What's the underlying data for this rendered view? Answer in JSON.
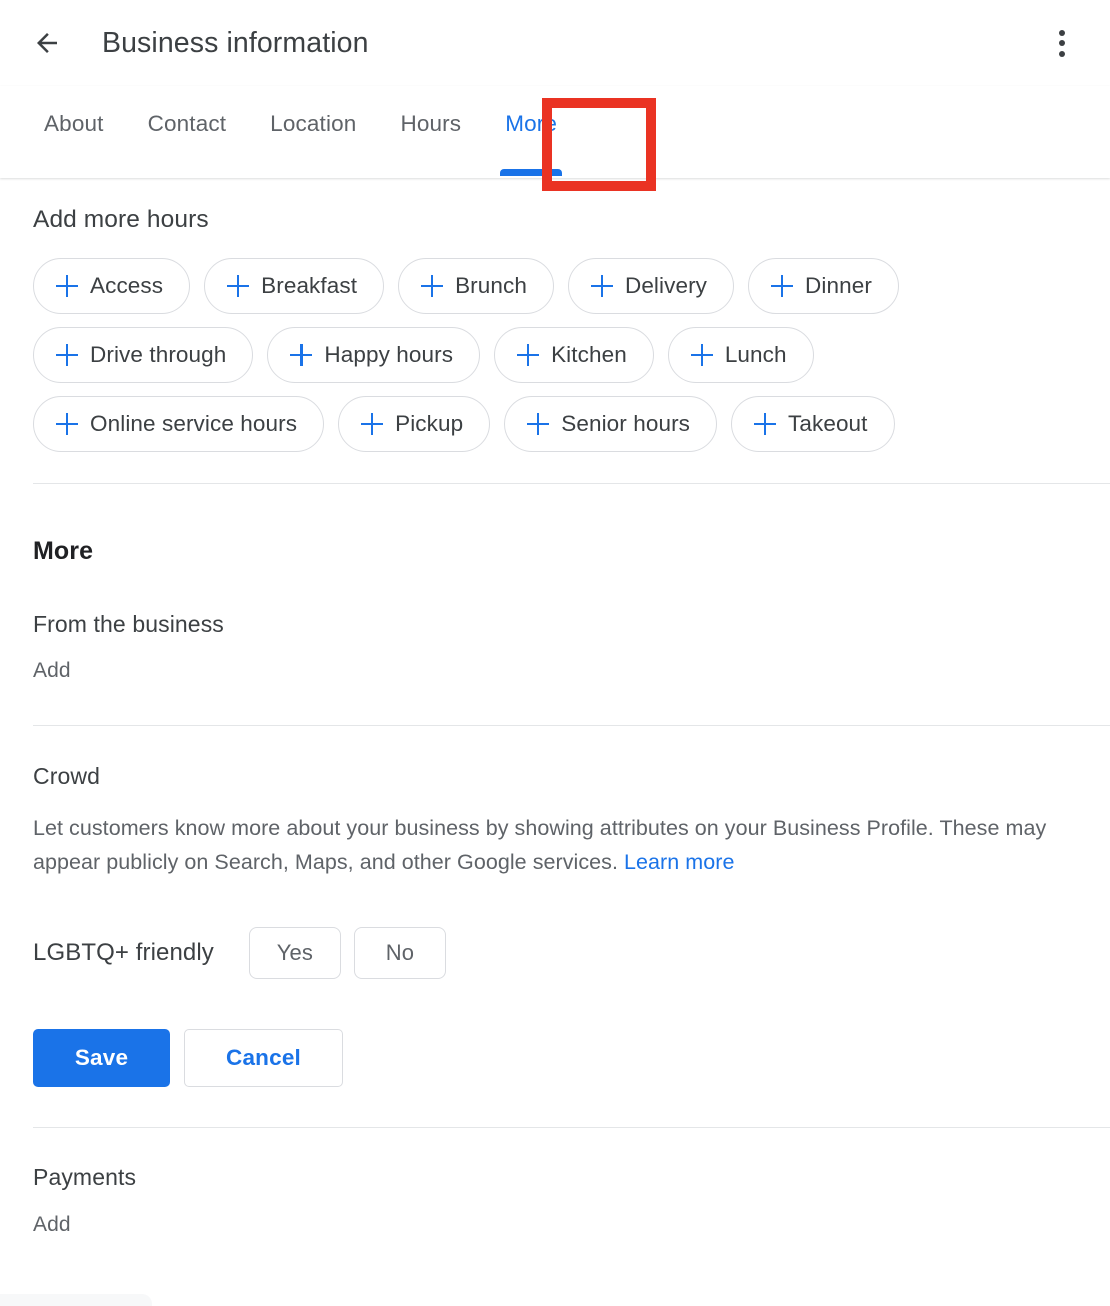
{
  "header": {
    "back_icon": "back-arrow-icon",
    "title": "Business information",
    "overflow_icon": "more-vert-icon"
  },
  "tabs": [
    {
      "label": "About",
      "active": false
    },
    {
      "label": "Contact",
      "active": false
    },
    {
      "label": "Location",
      "active": false
    },
    {
      "label": "Hours",
      "active": false
    },
    {
      "label": "More",
      "active": true
    }
  ],
  "annotation": {
    "target": "More",
    "color": "#ea3323"
  },
  "add_more_hours": {
    "title": "Add more hours",
    "plus_icon": "plus-icon",
    "rows": [
      [
        "Access",
        "Breakfast",
        "Brunch",
        "Delivery",
        "Dinner"
      ],
      [
        "Drive through",
        "Happy hours",
        "Kitchen",
        "Lunch"
      ],
      [
        "Online service hours",
        "Pickup",
        "Senior hours",
        "Takeout"
      ]
    ]
  },
  "more_section": {
    "heading": "More",
    "from_business": {
      "label": "From the business",
      "add_label": "Add"
    },
    "crowd": {
      "label": "Crowd",
      "description": "Let customers know more about your business by showing attributes on your Business Profile. These may appear publicly on Search, Maps, and other Google services.",
      "learn_more_label": "Learn more",
      "attribute": {
        "label": "LGBTQ+ friendly",
        "options": [
          "Yes",
          "No"
        ]
      },
      "save_label": "Save",
      "cancel_label": "Cancel"
    },
    "payments": {
      "label": "Payments",
      "add_label": "Add"
    }
  },
  "colors": {
    "accent": "#1a73e8",
    "annotation": "#ea3323",
    "text_primary": "#3c4043",
    "text_secondary": "#5f6368",
    "border": "#dadce0"
  }
}
